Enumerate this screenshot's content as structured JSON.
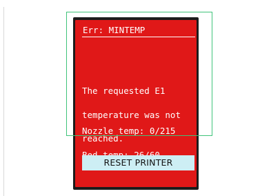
{
  "screen": {
    "error_title": "Err: MINTEMP",
    "message_lines": [
      "The requested E1",
      "temperature was not",
      "reached."
    ],
    "nozzle_temp": "Nozzle temp: 0/215",
    "bed_temp": "Bed temp: 26/60",
    "reset_button_label": "RESET PRINTER"
  },
  "colors": {
    "screen_background": "#e01818",
    "device_bezel": "#1c1c1c",
    "button_background": "#cdeef4",
    "highlight_outline": "#3fc37a",
    "text": "#ffffff"
  }
}
